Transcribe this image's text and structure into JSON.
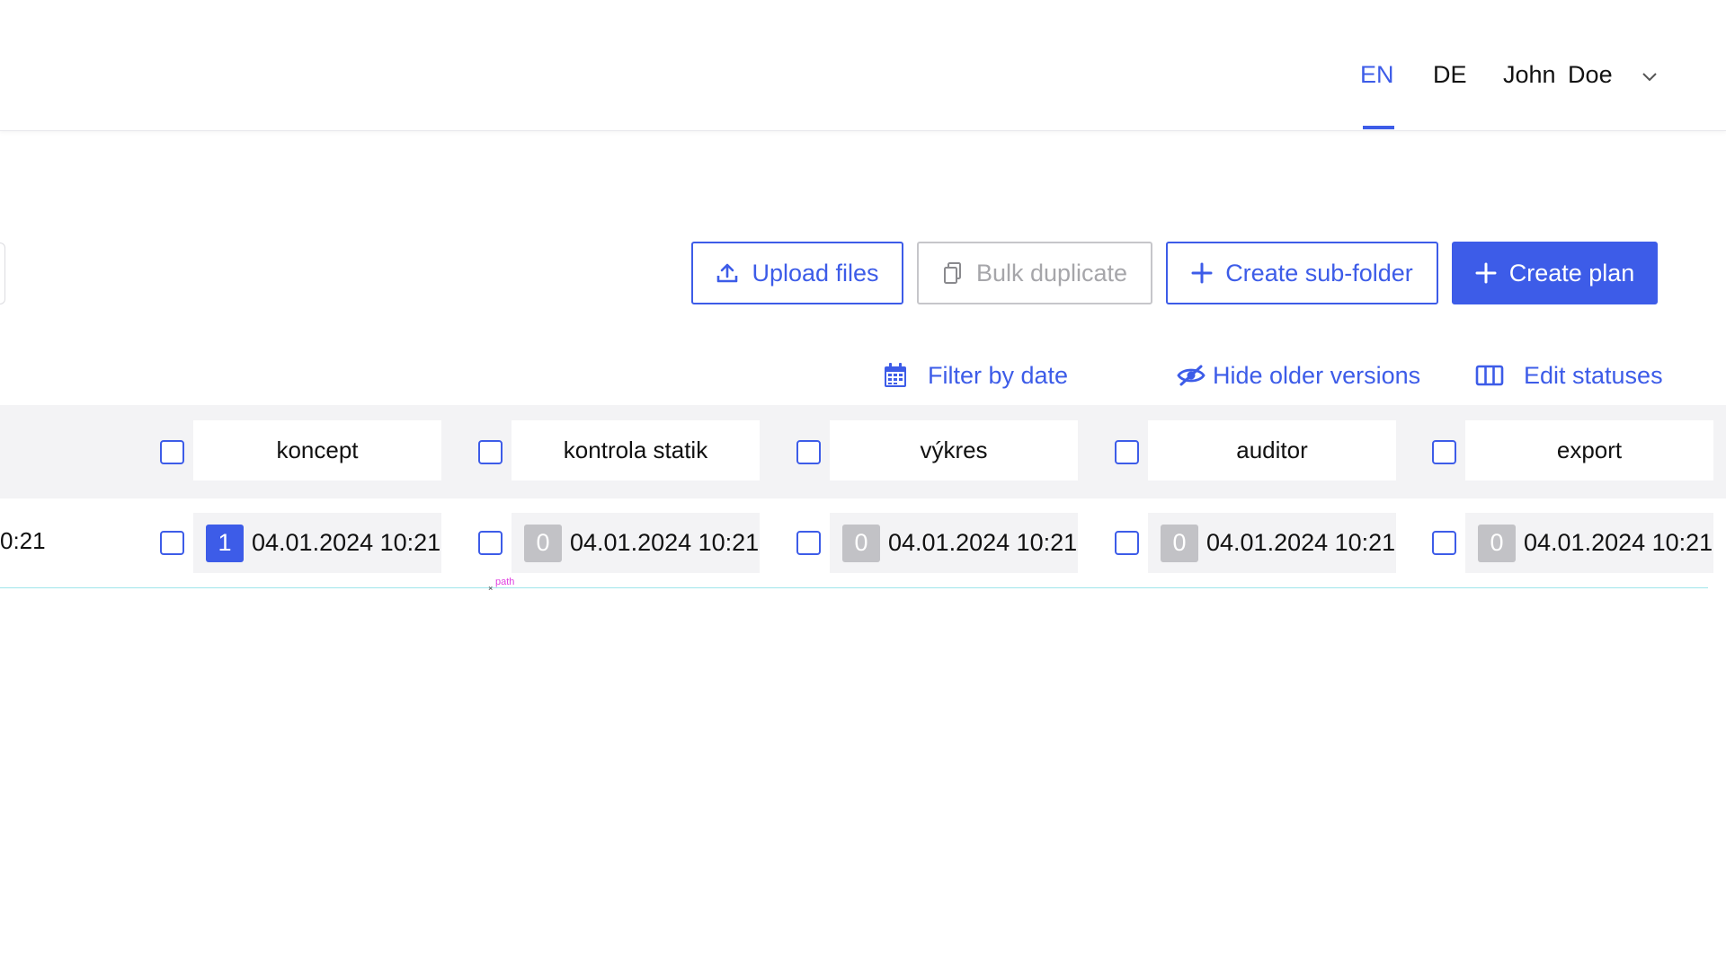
{
  "header": {
    "languages": [
      "EN",
      "DE"
    ],
    "active_language": "EN",
    "user_name": "John Doe"
  },
  "toolbar": {
    "upload_label": "Upload files",
    "bulk_duplicate_label": "Bulk duplicate",
    "create_subfolder_label": "Create sub-folder",
    "create_plan_label": "Create plan"
  },
  "actions": {
    "filter_label": "Filter by date",
    "hide_label": "Hide older versions",
    "edit_label": "Edit statuses"
  },
  "table": {
    "columns": [
      "koncept",
      "kontrola statik",
      "výkres",
      "auditor",
      "export"
    ],
    "row": {
      "partial_text": "0:21",
      "cells": [
        {
          "count": "1",
          "date": "04.01.2024 10:21",
          "active": true
        },
        {
          "count": "0",
          "date": "04.01.2024 10:21",
          "active": false
        },
        {
          "count": "0",
          "date": "04.01.2024 10:21",
          "active": false
        },
        {
          "count": "0",
          "date": "04.01.2024 10:21",
          "active": false
        },
        {
          "count": "0",
          "date": "04.01.2024 10:21",
          "active": false
        }
      ]
    }
  },
  "overlay": {
    "path_label": "path",
    "path_mark": "×"
  },
  "colors": {
    "accent": "#3d5ce8",
    "disabled": "#a6a6aa",
    "badge_inactive": "#c2c2c6",
    "row_line": "#9fe5ea"
  }
}
